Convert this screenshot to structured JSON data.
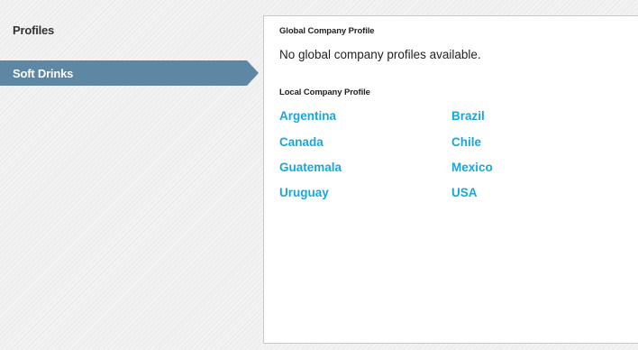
{
  "sidebar": {
    "title": "Profiles",
    "items": [
      {
        "label": "Soft Drinks",
        "selected": true
      }
    ]
  },
  "panel": {
    "global_heading": "Global Company Profile",
    "global_empty_message": "No global company profiles available.",
    "local_heading": "Local Company Profile",
    "countries": [
      "Argentina",
      "Brazil",
      "Canada",
      "Chile",
      "Guatemala",
      "Mexico",
      "Uruguay",
      "USA"
    ]
  },
  "colors": {
    "selected_item": "#5e87a3",
    "link": "#17a7d8",
    "background": "#eeeeee"
  }
}
